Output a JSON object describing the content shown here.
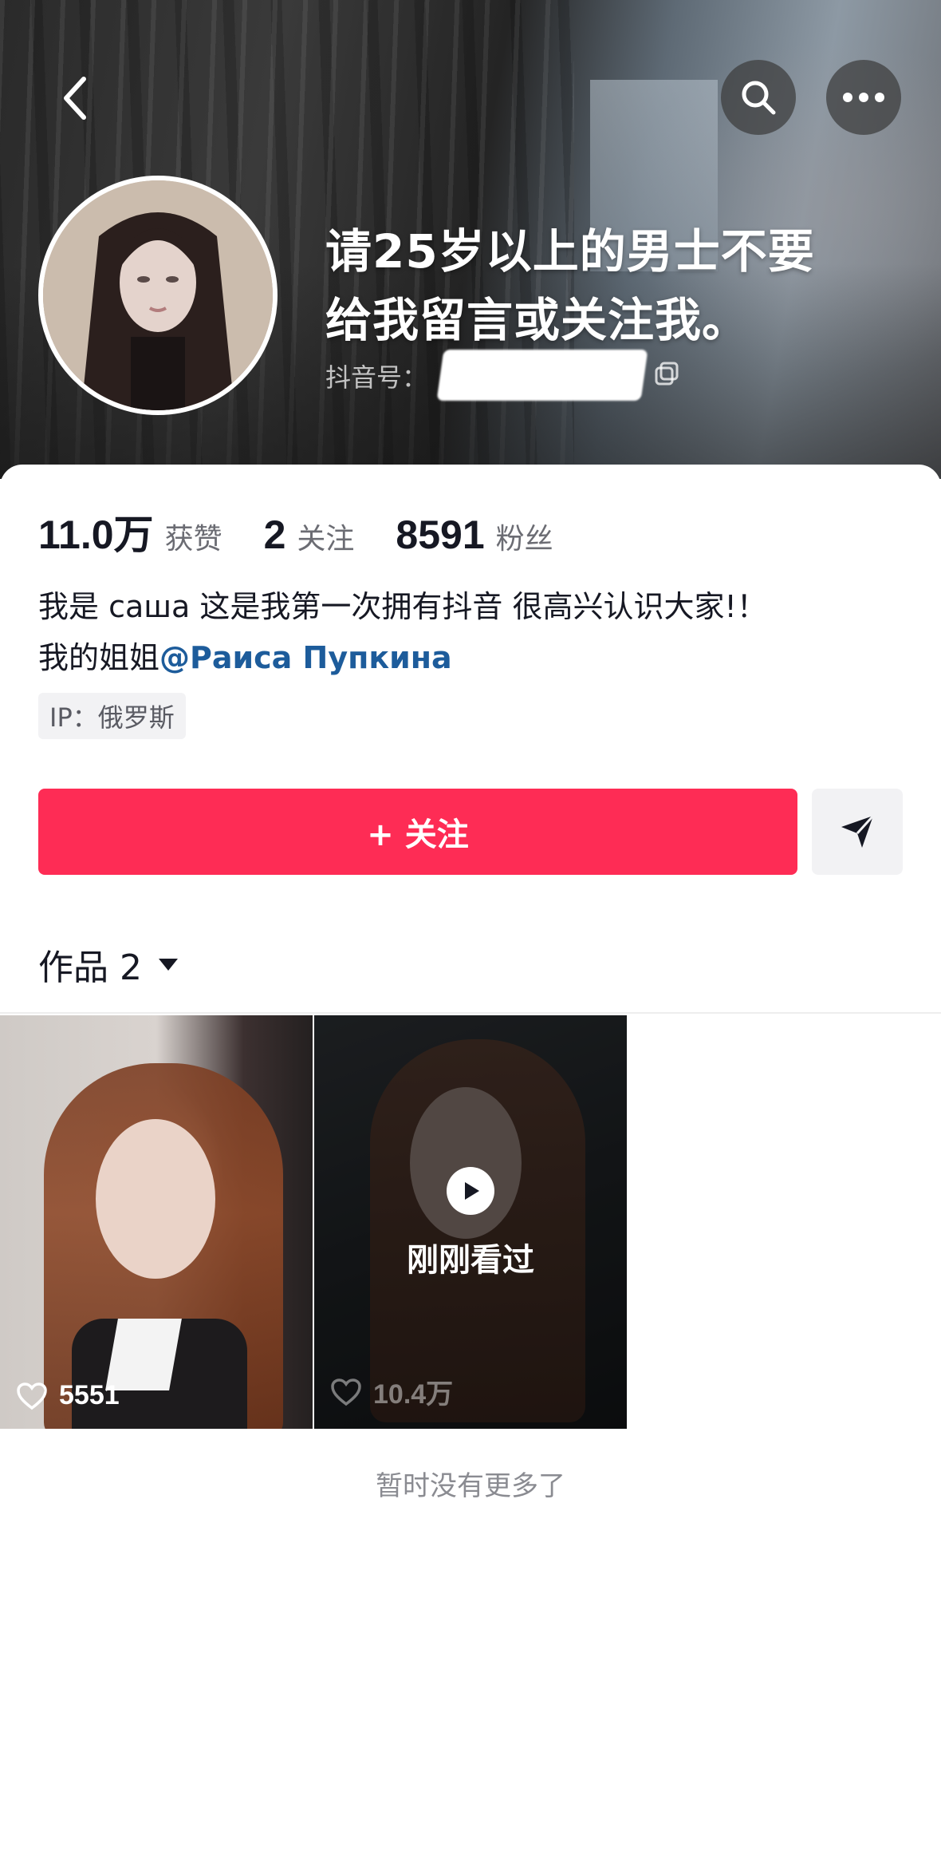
{
  "header": {
    "headline_line1": "请25岁以上的男士不要",
    "headline_line2": "给我留言或关注我。",
    "douyin_id_label": "抖音号："
  },
  "stats": [
    {
      "value": "11.0万",
      "label": "获赞"
    },
    {
      "value": "2",
      "label": "关注"
    },
    {
      "value": "8591",
      "label": "粉丝"
    }
  ],
  "bio": {
    "line1": "我是 саша 这是我第一次拥有抖音 很高兴认识大家!！",
    "line2_prefix": "我的姐姐",
    "mention": "@Раиса Пупкина"
  },
  "ip_tag": "IP：俄罗斯",
  "actions": {
    "follow_label": "+ 关注"
  },
  "works_tab": {
    "label": "作品 2"
  },
  "videos": [
    {
      "likes": "5551",
      "watched_label": ""
    },
    {
      "likes": "10.4万",
      "watched_label": "刚刚看过"
    }
  ],
  "footer": {
    "no_more": "暂时没有更多了"
  },
  "colors": {
    "accent": "#fe2c55",
    "mention": "#1d5c9b"
  }
}
